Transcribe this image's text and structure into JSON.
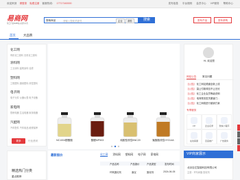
{
  "topbar": {
    "welcome": "欢迎来到",
    "login": "请登录",
    "register": "免费注册",
    "hotline_label": "客服热线：",
    "hotline": "17717160000",
    "links": [
      "发布信息",
      "平台规则",
      "会员中心",
      "VIP服务",
      "帮助中心"
    ]
  },
  "header": {
    "logo_text": "易商网",
    "logo_sub": "化工行业B2B电子商务平台",
    "search_category": "搜索商品",
    "search_placeholder": "请输入搜索关键词",
    "search_tabs": [
      "企业",
      "求购"
    ],
    "search_button": "搜索",
    "btn_publish": "发布产品",
    "btn_buy": "发布求购"
  },
  "nav": {
    "items": [
      "首页",
      "大品牌"
    ]
  },
  "sidebar": {
    "categories": [
      {
        "title": "化工网",
        "sub": "有机化工原料 无机化工原料"
      },
      {
        "title": "涂料网",
        "sub": "工业涂料 建筑涂料 油漆"
      },
      {
        "title": "塑料网",
        "sub": "工程塑料 通用塑料 改性塑料"
      },
      {
        "title": "电子网",
        "sub": "电子元件 仪器仪表 电子设备"
      },
      {
        "title": "家电网",
        "sub": "厨房电器 生活电器 家用电器"
      },
      {
        "title": "汽配网",
        "sub": "汽车配件 汽车用品 维修保养"
      }
    ],
    "more_button": "更多",
    "more_text": "行业资讯"
  },
  "banner": {
    "products": [
      {
        "caption": "NC1004酚醛胺",
        "liquid": "#e2d58a"
      },
      {
        "caption": "酚醛MP503",
        "liquid": "#6a1d10"
      },
      {
        "caption": "纯胺型改性BNC20",
        "liquid": "#d9c070"
      },
      {
        "caption": "聚醚胺改性HY314A",
        "liquid": "#c07a24"
      }
    ],
    "active_slide": 1
  },
  "right": {
    "welcome": "Hi, 欢迎您",
    "tabs": [
      "网站公告",
      "常见问题"
    ],
    "news": [
      {
        "tag": "【公告】",
        "text": "化工网站频道全新上线"
      },
      {
        "tag": "【公告】",
        "text": "莫让付款风险不让无忧"
      },
      {
        "tag": "【公告】",
        "text": "化工企业会员等级说明"
      },
      {
        "tag": "【公告】",
        "text": "电商物流发货渠道门..."
      },
      {
        "tag": "【公告】",
        "text": "化工网络进行营销方案"
      }
    ],
    "services_title": "专享服务",
    "services": [
      "VIP",
      "企业名录",
      "微信小程序",
      "在线客服",
      "百度推广",
      "广告服务"
    ]
  },
  "bottom": {
    "left_title": "精选热门分类",
    "left_sub": "重点推荐",
    "quote_title": "最新报价",
    "quote_tabs": [
      "化工网",
      "涂料网",
      "塑料网",
      "电子网",
      "家电网"
    ],
    "quote_headers": [
      "产品名称",
      "产品报价",
      "产品类型",
      "发布时间"
    ],
    "quote_rows": [
      [
        "环氧固化剂",
        "面议",
        "固化剂",
        "2024-06-05"
      ]
    ],
    "vip_title": "VIP商家展示",
    "vip_name": "北京百达智能科技有限公司",
    "vip_desc": "主营：环氧树脂 固化剂"
  },
  "colors": {
    "accent": "#2f6fd6",
    "brand_red": "#e4393c"
  }
}
